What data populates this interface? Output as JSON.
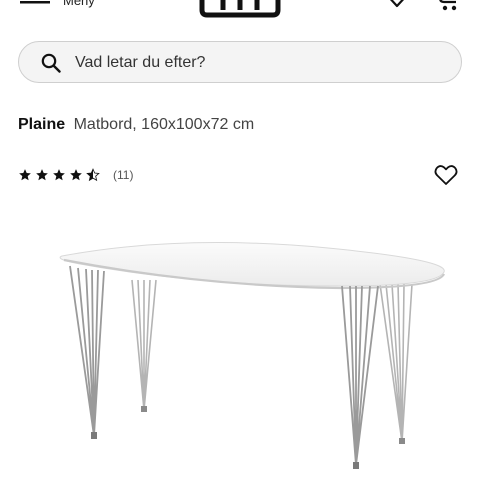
{
  "header": {
    "menu_label": "Meny",
    "menu_icon": "hamburger-icon",
    "logo_icon": "store-logo",
    "wishlist_icon": "heart-icon",
    "cart_icon": "cart-icon"
  },
  "search": {
    "placeholder": "Vad letar du efter?",
    "icon": "search-icon"
  },
  "product": {
    "brand": "Plaine",
    "description": "Matbord, 160x100x72 cm",
    "rating": 4.5,
    "rating_max": 5,
    "review_count_text": "(11)",
    "favorite_icon": "heart-outline-icon",
    "image": "white-oval-dining-table-chrome-legs"
  },
  "colors": {
    "text": "#111111",
    "search_background": "#f4f4f4",
    "search_border": "#cfcfcf",
    "table_top": "#f7f7f7",
    "chrome": "#9a9a9a"
  }
}
